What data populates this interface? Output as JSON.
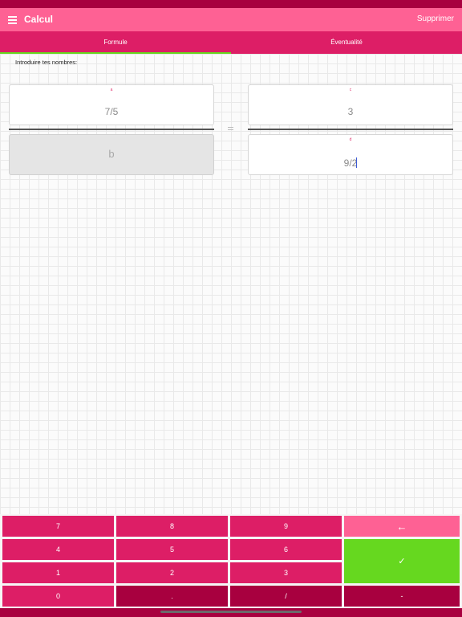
{
  "app": {
    "title": "Calcul",
    "delete_label": "Supprimer"
  },
  "tabs": [
    {
      "label": "Formule",
      "active": true
    },
    {
      "label": "Éventualité",
      "active": false
    }
  ],
  "prompt": "Introduire tes nombres:",
  "fields": {
    "a": {
      "tag": "a",
      "value": "7/5"
    },
    "b": {
      "tag": "",
      "placeholder": "b",
      "value": ""
    },
    "c": {
      "tag": "c",
      "value": "3"
    },
    "d": {
      "tag": "d",
      "value": "9/2",
      "focused": true
    }
  },
  "equals_symbol": "=",
  "keypad": {
    "k7": "7",
    "k8": "8",
    "k9": "9",
    "backspace": "←",
    "k4": "4",
    "k5": "5",
    "k6": "6",
    "confirm": "✓",
    "k1": "1",
    "k2": "2",
    "k3": "3",
    "k0": "0",
    "dot": ".",
    "slash": "/",
    "minus": "-"
  },
  "colors": {
    "appbar": "#fe6194",
    "tabbar": "#dd1e66",
    "accent_green": "#66d81f",
    "key_dark": "#a8003f"
  },
  "icons": {
    "menu": "menu-icon",
    "backspace": "backspace-arrow-icon",
    "confirm": "checkmark-icon"
  }
}
